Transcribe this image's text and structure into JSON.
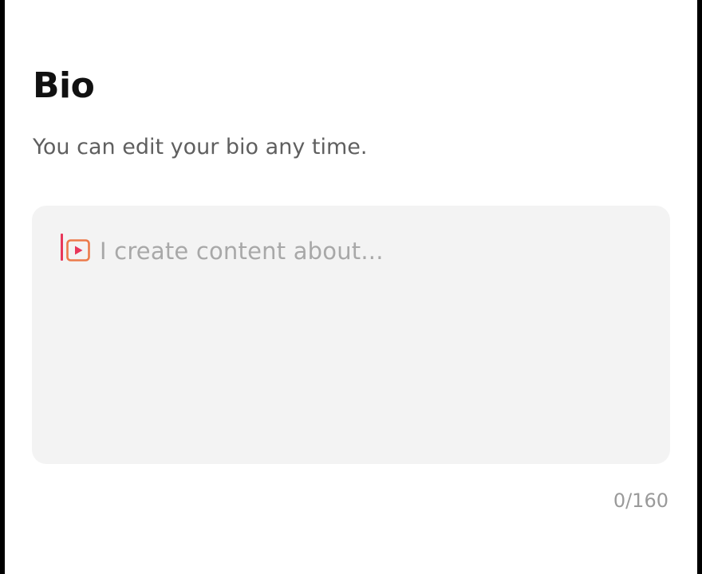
{
  "bio": {
    "title": "Bio",
    "subtitle": "You can edit your bio any time.",
    "input": {
      "placeholder": "I create content about...",
      "value": "",
      "icon": "video-play-icon",
      "caret_color": "#e8375a",
      "icon_color": "#ec7a4a"
    },
    "counter": "0/160"
  }
}
